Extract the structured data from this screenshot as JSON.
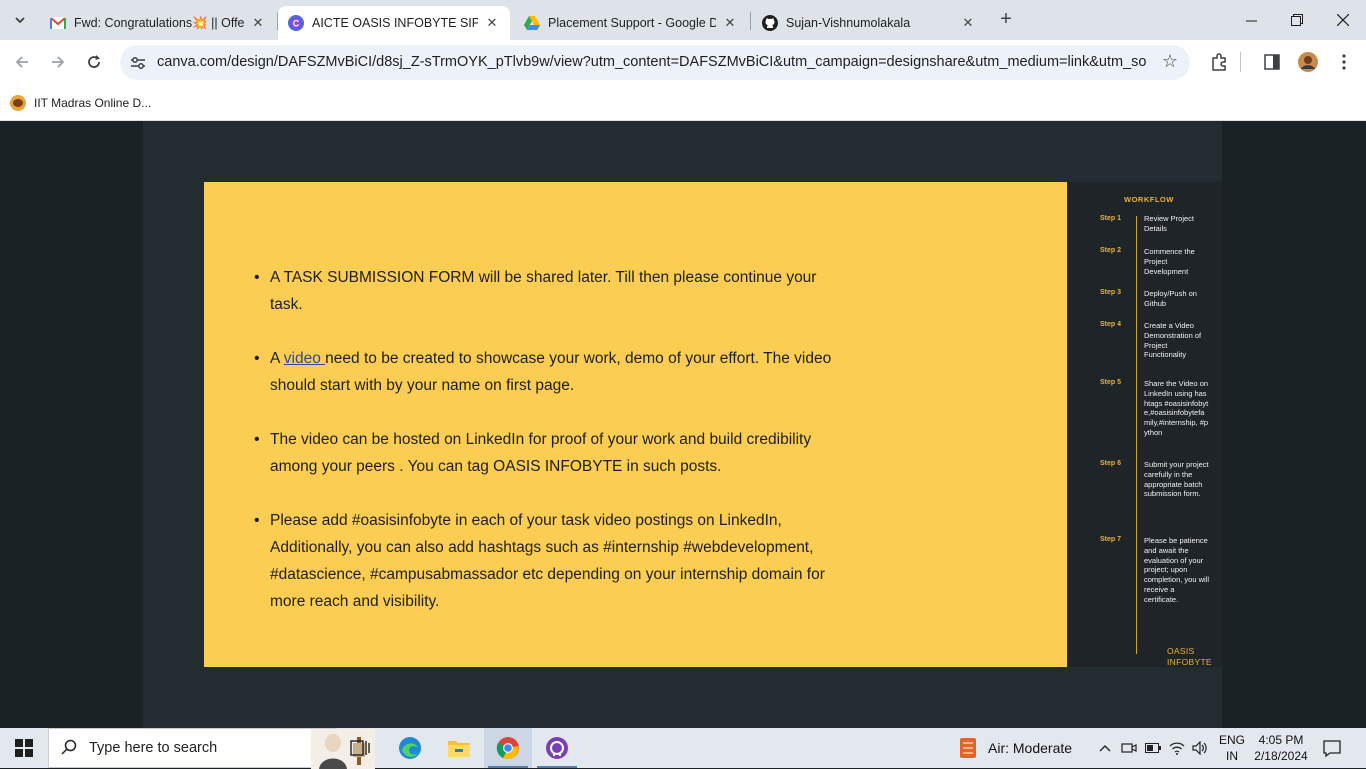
{
  "browser": {
    "tabs": [
      {
        "title": "Fwd: Congratulations💥 || Offer",
        "icon": "gmail-icon",
        "active": false
      },
      {
        "title": "AICTE OASIS INFOBYTE SIP TASK",
        "icon": "canva-icon",
        "active": true
      },
      {
        "title": "Placement Support - Google Dri",
        "icon": "google-drive-icon",
        "active": false
      },
      {
        "title": "Sujan-Vishnumolakala",
        "icon": "github-icon",
        "active": false
      }
    ],
    "url": "canva.com/design/DAFSZMvBiCI/d8sj_Z-sTrmOYK_pTlvb9w/view?utm_content=DAFSZMvBiCI&utm_campaign=designshare&utm_medium=link&utm_source=p...",
    "bookmarks": [
      {
        "label": "IIT Madras Online D..."
      }
    ]
  },
  "slide": {
    "bullets": {
      "b1": "A TASK SUBMISSION FORM will be shared later. Till then please continue your task.",
      "b2_prefix": "A ",
      "b2_link": "video ",
      "b2_rest": "need to be created to showcase your work, demo of your effort. The video should start with by your name on first page.",
      "b3": "The video can be hosted on LinkedIn for proof of your work and build credibility among your peers . You can tag OASIS INFOBYTE in such posts.",
      "b4": "Please add #oasisinfobyte in each of your task video postings on LinkedIn, Additionally, you can also add hashtags such as #internship #webdevelopment, #datascience, #campusabmassador etc depending on your internship domain for more  reach and visibility."
    },
    "colors": {
      "background": "#fbcd52",
      "link": "#2b4a9b"
    }
  },
  "workflow": {
    "title": "WORKFLOW",
    "steps": [
      {
        "label": "Step 1",
        "text": "Review Project Details"
      },
      {
        "label": "Step 2",
        "text": "Commence the Project Development"
      },
      {
        "label": "Step 3",
        "text": "Deploy/Push on Github"
      },
      {
        "label": "Step 4",
        "text": "Create a Video Demonstration of Project Functionality"
      },
      {
        "label": "Step 5",
        "text": "Share the Video on LinkedIn using hashtags #oasisinfobyte,#oasisinfobytefamily,#internship, #python"
      },
      {
        "label": "Step 6",
        "text": "Submit your project carefully in the appropriate batch submission form."
      },
      {
        "label": "Step 7",
        "text": "Please be patience and await the evaluation of your project; upon completion, you will receive a certificate."
      }
    ],
    "brand_line1": "OASIS",
    "brand_line2": "INFOBYTE",
    "accent_color": "#e8b23a"
  },
  "taskbar": {
    "search_placeholder": "Type here to search",
    "weather": "Air: Moderate",
    "lang_line1": "ENG",
    "lang_line2": "IN",
    "time": "4:05 PM",
    "date": "2/18/2024"
  }
}
